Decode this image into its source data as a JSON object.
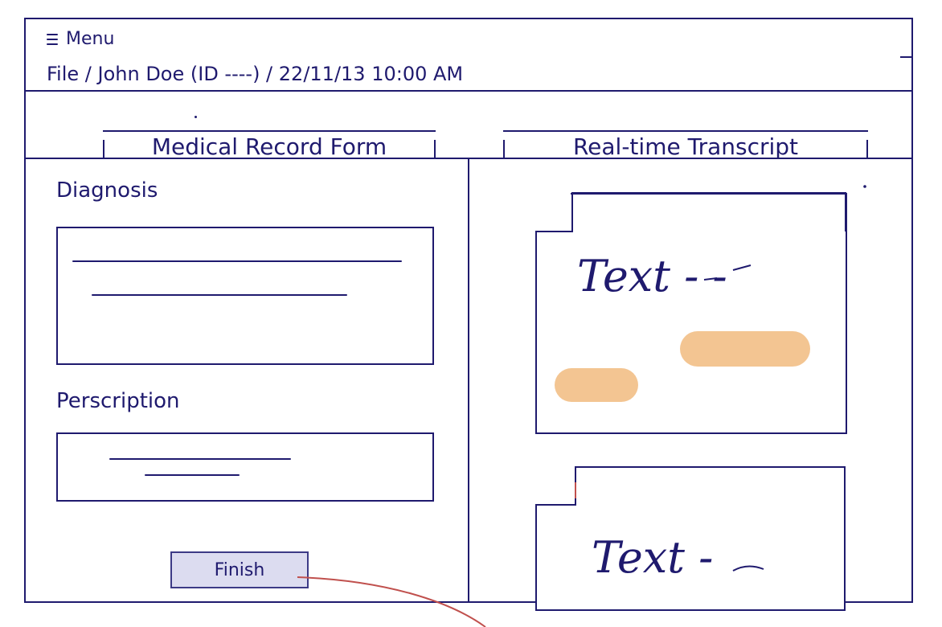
{
  "header": {
    "menu_label": "Menu",
    "breadcrumb": "File / John Doe (ID ----) / 22/11/13 10:00 AM"
  },
  "columns": {
    "left_title": "Medical Record Form",
    "right_title": "Real-time Transcript"
  },
  "form": {
    "diagnosis_label": "Diagnosis",
    "prescription_label": "Perscription",
    "finish_label": "Finish"
  },
  "transcript": {
    "card1_text": "Text - -",
    "card2_text": "Text -"
  },
  "colors": {
    "ink": "#1f1a6e",
    "highlight": "#f3c592",
    "button_fill": "#dcdcf0",
    "annotation_line": "#c0504d"
  }
}
